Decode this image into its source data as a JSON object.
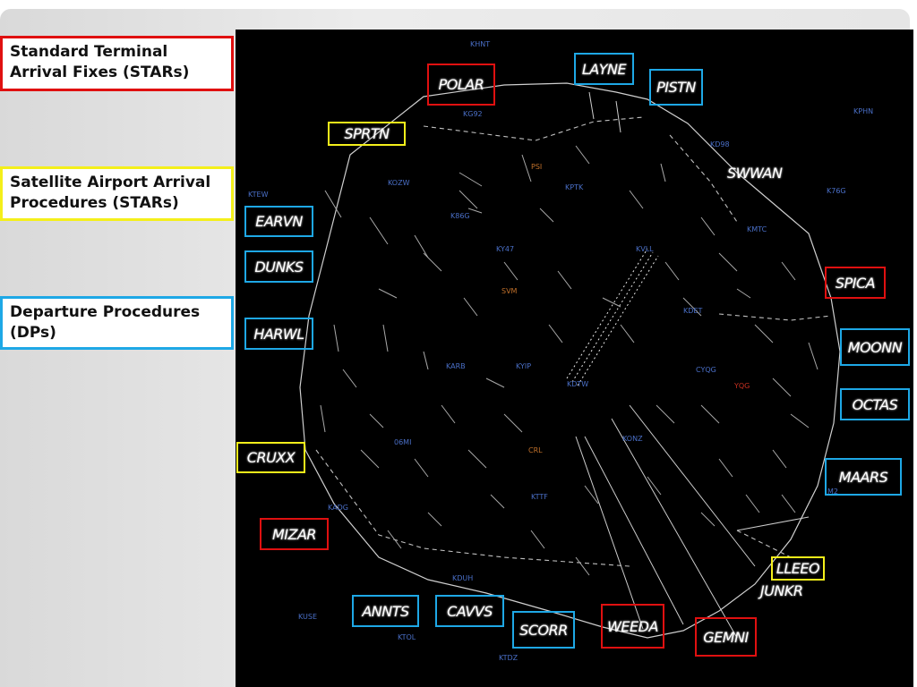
{
  "legend": {
    "stars": [
      "Standard Terminal",
      "Arrival Fixes (STARs)"
    ],
    "satellite": [
      "Satellite Airport Arrival",
      "Procedures (STARs)"
    ],
    "dps": [
      "Departure Procedures",
      "(DPs)"
    ]
  },
  "colors": {
    "stars": "#e01010",
    "satellite": "#f4ef1a",
    "dps": "#1ea8e6",
    "background": "#000000"
  },
  "fixes": [
    {
      "name": "POLAR",
      "type": "star"
    },
    {
      "name": "LAYNE",
      "type": "dp"
    },
    {
      "name": "PISTN",
      "type": "dp"
    },
    {
      "name": "SPRTN",
      "type": "satellite"
    },
    {
      "name": "EARVN",
      "type": "dp"
    },
    {
      "name": "DUNKS",
      "type": "dp"
    },
    {
      "name": "HARWL",
      "type": "dp"
    },
    {
      "name": "SPICA",
      "type": "star"
    },
    {
      "name": "MOONN",
      "type": "dp"
    },
    {
      "name": "OCTAS",
      "type": "dp"
    },
    {
      "name": "MAARS",
      "type": "dp"
    },
    {
      "name": "CRUXX",
      "type": "satellite"
    },
    {
      "name": "MIZAR",
      "type": "star"
    },
    {
      "name": "LLEEO",
      "type": "satellite"
    },
    {
      "name": "ANNTS",
      "type": "dp"
    },
    {
      "name": "CAVVS",
      "type": "dp"
    },
    {
      "name": "SCORR",
      "type": "dp"
    },
    {
      "name": "WEEDA",
      "type": "star"
    },
    {
      "name": "GEMNI",
      "type": "star"
    }
  ],
  "unboxed_fixes": [
    "SWWAN",
    "JUNKR"
  ],
  "airports": [
    "KHNT",
    "KG92",
    "KPHN",
    "KD98",
    "PSI",
    "KOZW",
    "KPTK",
    "K76G",
    "KTEW",
    "KMTC",
    "K86G",
    "KVLL",
    "KY47",
    "SVM",
    "KDET",
    "KARB",
    "KYIP",
    "KDTW",
    "CYQG",
    "YQG",
    "KONZ",
    "06MI",
    "CRL",
    "M2",
    "KADG",
    "KTTF",
    "KDUH",
    "KUSE",
    "KTOL",
    "KTDZ"
  ]
}
